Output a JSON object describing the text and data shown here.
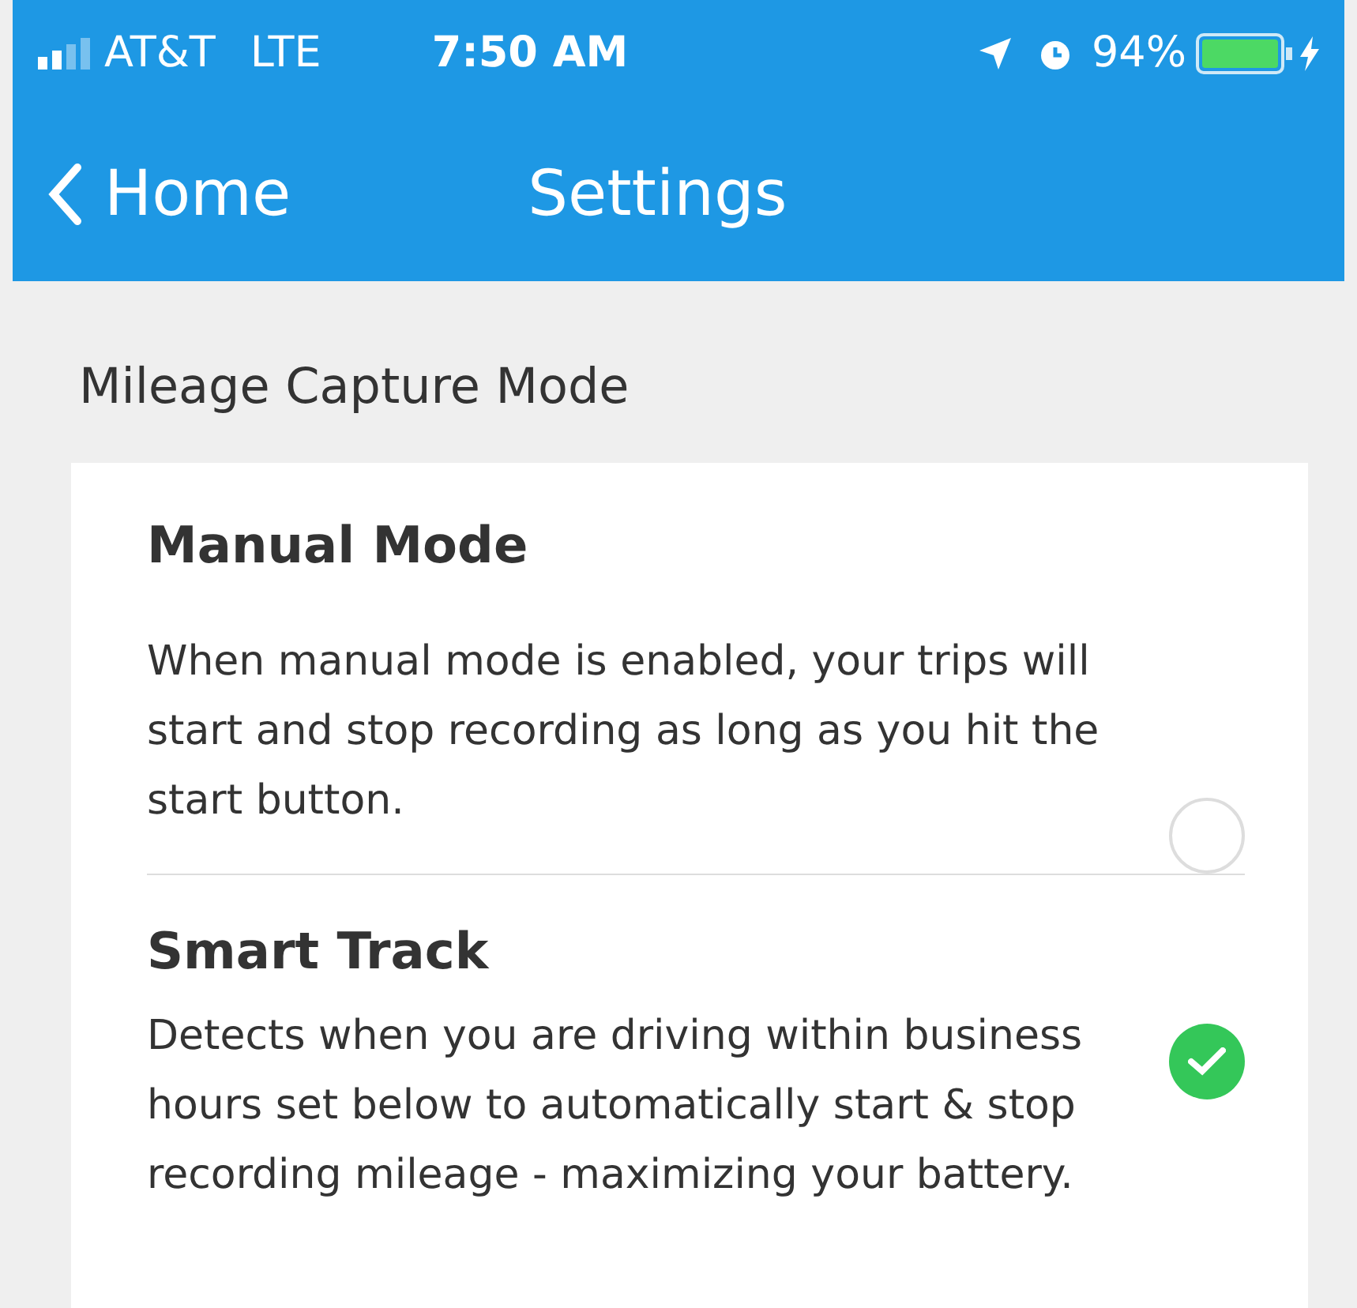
{
  "status_bar": {
    "carrier": "AT&T",
    "network": "LTE",
    "time": "7:50 AM",
    "battery": "94%"
  },
  "nav": {
    "back": "Home",
    "title": "Settings"
  },
  "section": {
    "title": "Mileage Capture Mode",
    "options": [
      {
        "title": "Manual Mode",
        "description": "When manual mode is enabled, your trips will start and stop recording as long as you hit the start button.",
        "selected": false
      },
      {
        "title": "Smart Track",
        "description": "Detects when you are driving within business hours set below to automatically start & stop recording mileage - maximizing your battery.",
        "selected": true
      }
    ]
  }
}
